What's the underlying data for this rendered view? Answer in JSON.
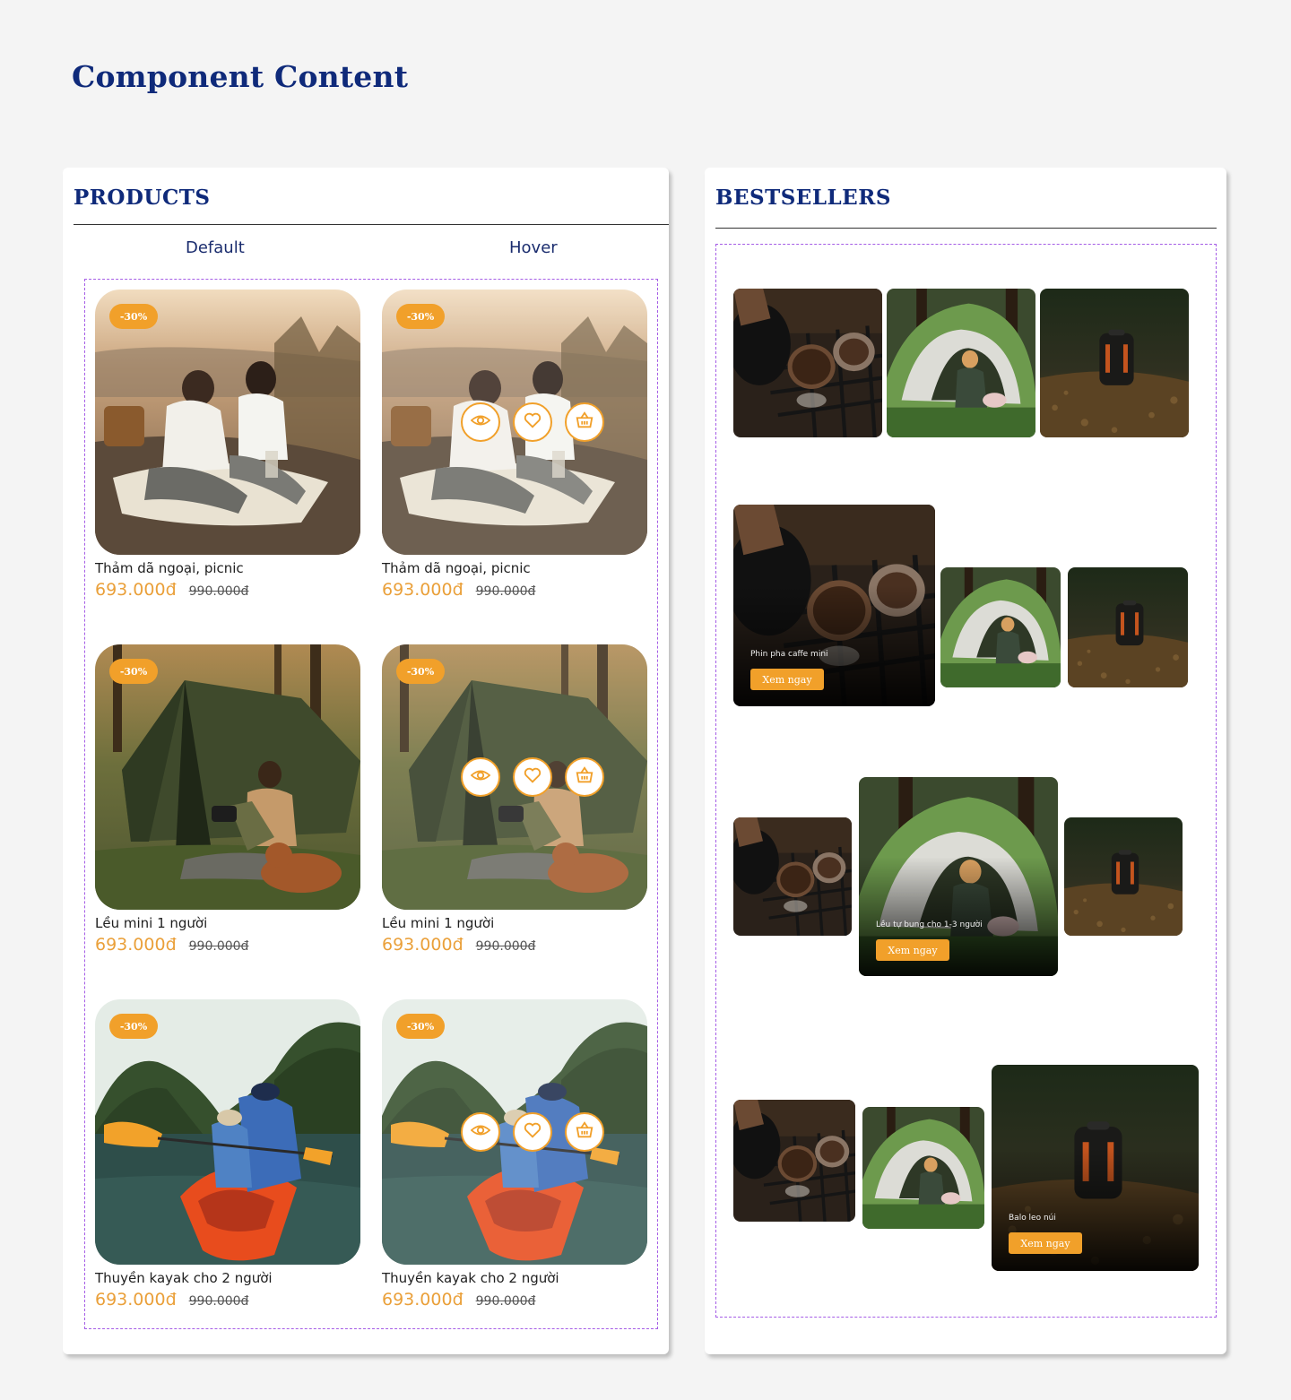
{
  "page": {
    "title": "Component Content"
  },
  "products": {
    "heading": "PRODUCTS",
    "columns": {
      "default": "Default",
      "hover": "Hover"
    },
    "items": [
      {
        "badge": "-30%",
        "name": "Thảm dã ngoại, picnic",
        "price": "693.000đ",
        "old_price": "990.000đ"
      },
      {
        "badge": "-30%",
        "name": "Lều mini 1 người",
        "price": "693.000đ",
        "old_price": "990.000đ"
      },
      {
        "badge": "-30%",
        "name": "Thuyền kayak cho 2 người",
        "price": "693.000đ",
        "old_price": "990.000đ"
      }
    ],
    "hover_icons": [
      "eye-icon",
      "heart-icon",
      "basket-icon"
    ]
  },
  "bestsellers": {
    "heading": "BESTSELLERS",
    "featured": [
      {
        "caption": "Phin pha caffe mini",
        "button": "Xem ngay"
      },
      {
        "caption": "Lều tự bung cho 1-3 người",
        "button": "Xem ngay"
      },
      {
        "caption": "Balo leo núi",
        "button": "Xem ngay"
      }
    ]
  },
  "colors": {
    "title_blue": "#0f2a7a",
    "accent_orange": "#f1a02a",
    "dash_purple": "#a55de6"
  }
}
